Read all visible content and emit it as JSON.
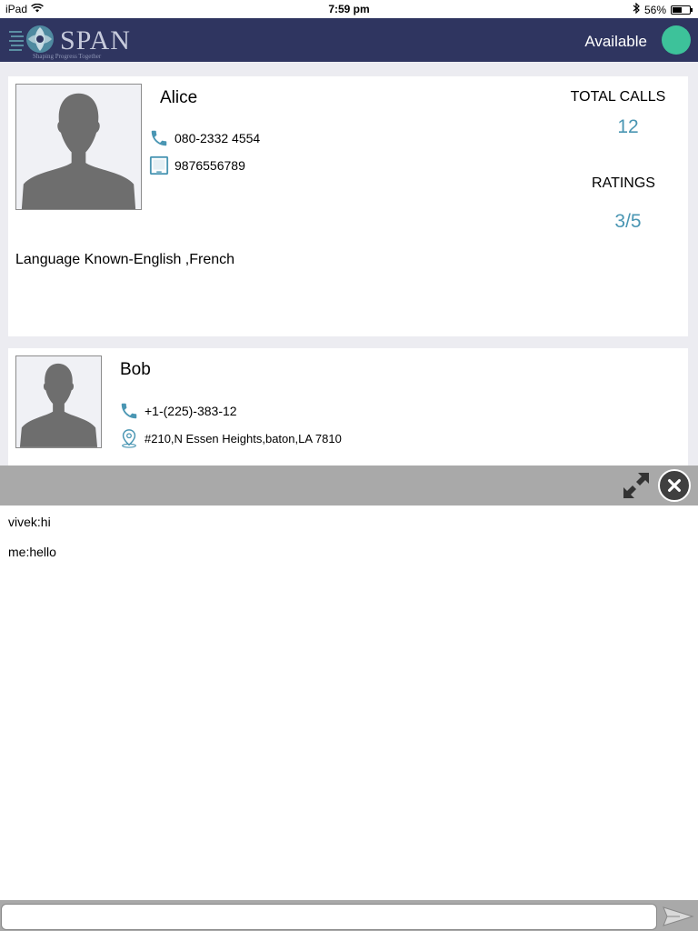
{
  "status_bar": {
    "device": "iPad",
    "time": "7:59 pm",
    "battery": "56%",
    "battery_level": 0.56
  },
  "header": {
    "logo_text": "SPAN",
    "logo_tagline": "Shaping Progress Together",
    "availability_label": "Available",
    "availability_color": "#3dc29a",
    "brand_color": "#2f3560"
  },
  "contacts": [
    {
      "name": "Alice",
      "phone": "080-2332 4554",
      "mobile": "9876556789",
      "languages": "Language Known-English ,French",
      "total_calls_label": "TOTAL CALLS",
      "total_calls": "12",
      "ratings_label": "RATINGS",
      "rating": "3/5"
    },
    {
      "name": "Bob",
      "phone": "+1-(225)-383-12",
      "address": "#210,N Essen Heights,baton,LA 7810"
    }
  ],
  "chat": {
    "messages": [
      {
        "text": "vivek:hi"
      },
      {
        "text": "me:hello"
      }
    ],
    "input_value": "",
    "input_placeholder": ""
  },
  "icons": {
    "phone": "phone-icon",
    "mobile": "tablet-icon",
    "location": "location-pin-icon",
    "expand": "expand-icon",
    "close": "close-icon",
    "send": "send-icon"
  },
  "accent_color": "#4a96b3"
}
